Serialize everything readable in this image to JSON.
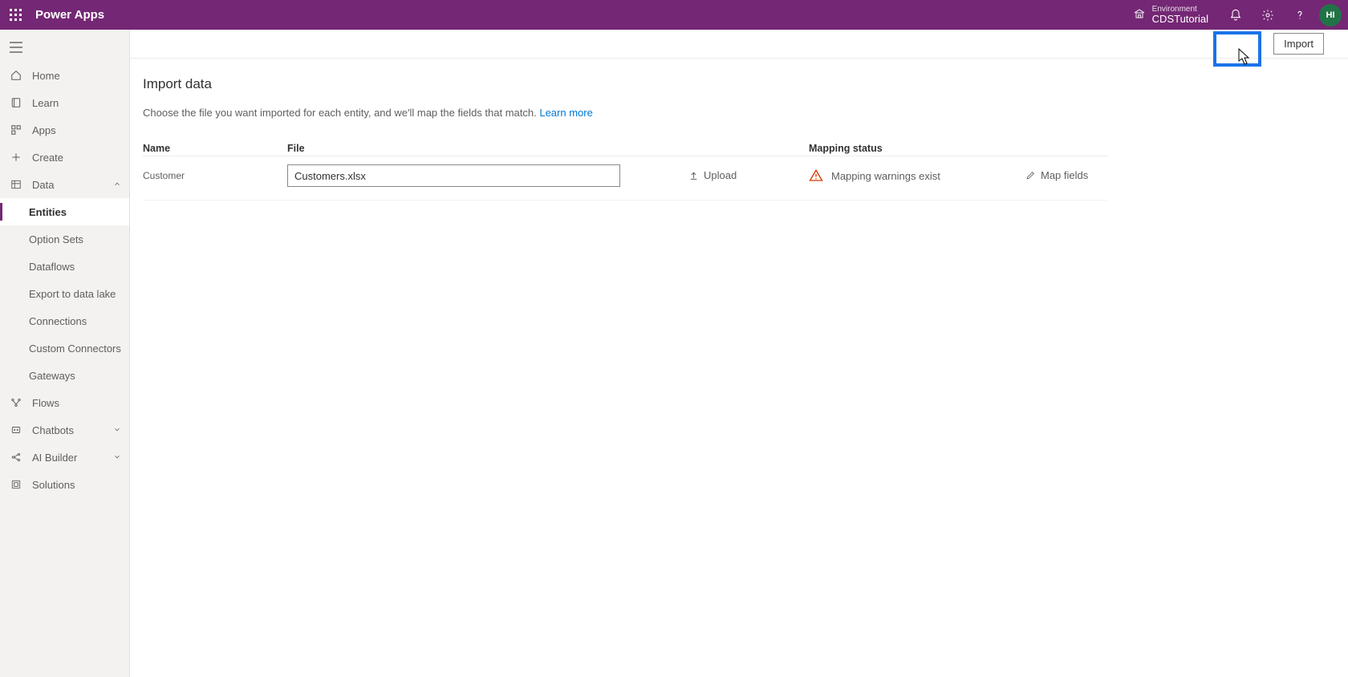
{
  "header": {
    "app_title": "Power Apps",
    "environment_label": "Environment",
    "environment_value": "CDSTutorial",
    "avatar_initials": "HI"
  },
  "cmdbar": {
    "import_label": "Import"
  },
  "sidebar": {
    "home": "Home",
    "learn": "Learn",
    "apps": "Apps",
    "create": "Create",
    "data": "Data",
    "data_children": {
      "entities": "Entities",
      "option_sets": "Option Sets",
      "dataflows": "Dataflows",
      "export_lake": "Export to data lake",
      "connections": "Connections",
      "custom_connectors": "Custom Connectors",
      "gateways": "Gateways"
    },
    "flows": "Flows",
    "chatbots": "Chatbots",
    "ai_builder": "AI Builder",
    "solutions": "Solutions"
  },
  "page": {
    "title": "Import data",
    "description_prefix": "Choose the file you want imported for each entity, and we'll map the fields that match. ",
    "learn_more": "Learn more"
  },
  "table": {
    "col_name": "Name",
    "col_file": "File",
    "col_mapping": "Mapping status",
    "rows": [
      {
        "name": "Customer",
        "file_value": "Customers.xlsx",
        "upload_label": "Upload",
        "status_text": "Mapping warnings exist",
        "mapfields_label": "Map fields"
      }
    ]
  }
}
